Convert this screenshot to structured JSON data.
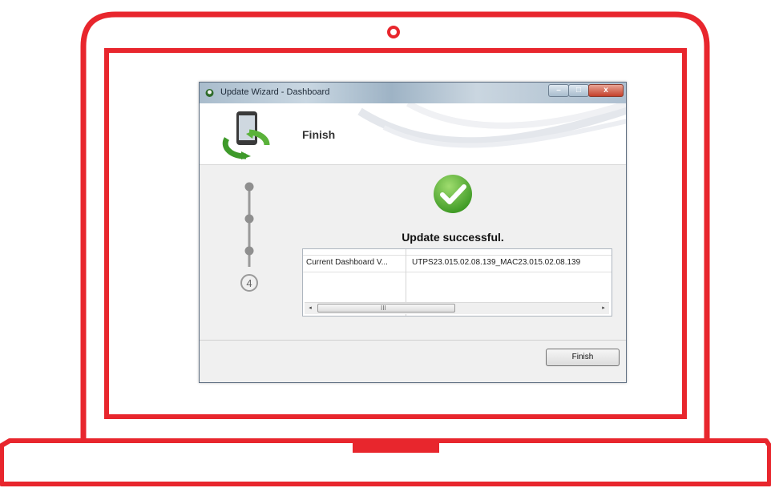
{
  "window": {
    "title": "Update Wizard - Dashboard",
    "controls": {
      "minimize": "–",
      "maximize": "□",
      "close": "x"
    }
  },
  "header": {
    "heading": "Finish",
    "logo_icon": "phone-sync-icon"
  },
  "stepper": {
    "total_steps": 4,
    "current_step": "4"
  },
  "result": {
    "icon": "check-circle-icon",
    "status": "Update successful."
  },
  "details": {
    "rows": [
      {
        "name": "Current Dashboard V...",
        "value": "UTPS23.015.02.08.139_MAC23.015.02.08.139"
      }
    ],
    "scrollbar": {
      "left_arrow": "◂",
      "right_arrow": "▸",
      "grip": "III"
    }
  },
  "footer": {
    "finish_label": "Finish"
  },
  "colors": {
    "laptop_outline": "#e8262d",
    "success_green": "#5ab23a",
    "titlebar": "#b4c6d6",
    "close_button": "#c4402b"
  }
}
